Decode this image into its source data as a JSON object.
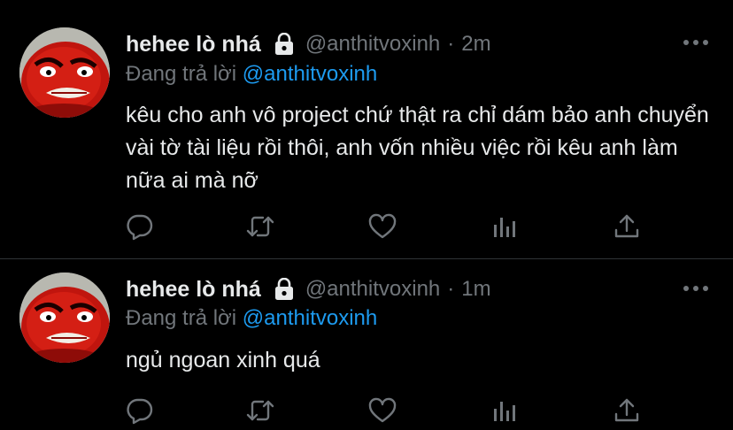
{
  "tweets": [
    {
      "display_name": "hehee lò nhá",
      "handle": "@anthitvoxinh",
      "separator": "·",
      "time": "2m",
      "reply_prefix": "Đang trả lời",
      "reply_to": "@anthitvoxinh",
      "text": "kêu cho anh vô project chứ thật ra chỉ dám bảo anh chuyển vài tờ tài liệu rồi thôi, anh vốn nhiều việc rồi kêu anh làm nữa ai mà nỡ"
    },
    {
      "display_name": "hehee lò nhá",
      "handle": "@anthitvoxinh",
      "separator": "·",
      "time": "1m",
      "reply_prefix": "Đang trả lời",
      "reply_to": "@anthitvoxinh",
      "text": "ngủ ngoan xinh quá"
    }
  ],
  "icons": {
    "lock": "lock-icon",
    "more": "more-icon",
    "reply": "comment-icon",
    "retweet": "retweet-icon",
    "like": "heart-icon",
    "analytics": "analytics-icon",
    "share": "share-icon"
  },
  "colors": {
    "background": "#000000",
    "text": "#e7e9ea",
    "muted": "#71767b",
    "accent": "#1d9bf0",
    "divider": "#2f3336"
  }
}
